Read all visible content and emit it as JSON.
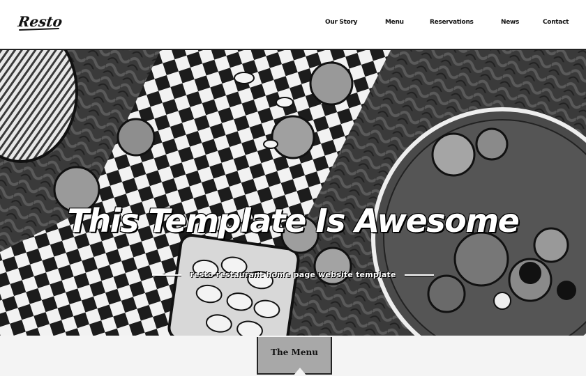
{
  "header": {
    "logo": "Resto",
    "nav": [
      {
        "label": "Our Story"
      },
      {
        "label": "Menu"
      },
      {
        "label": "Reservations"
      },
      {
        "label": "News"
      },
      {
        "label": "Contact"
      }
    ]
  },
  "hero": {
    "title": "This Template Is Awesome",
    "subtitle": "resto restaurant home page website template"
  },
  "menu_tab": {
    "label": "The Menu"
  }
}
